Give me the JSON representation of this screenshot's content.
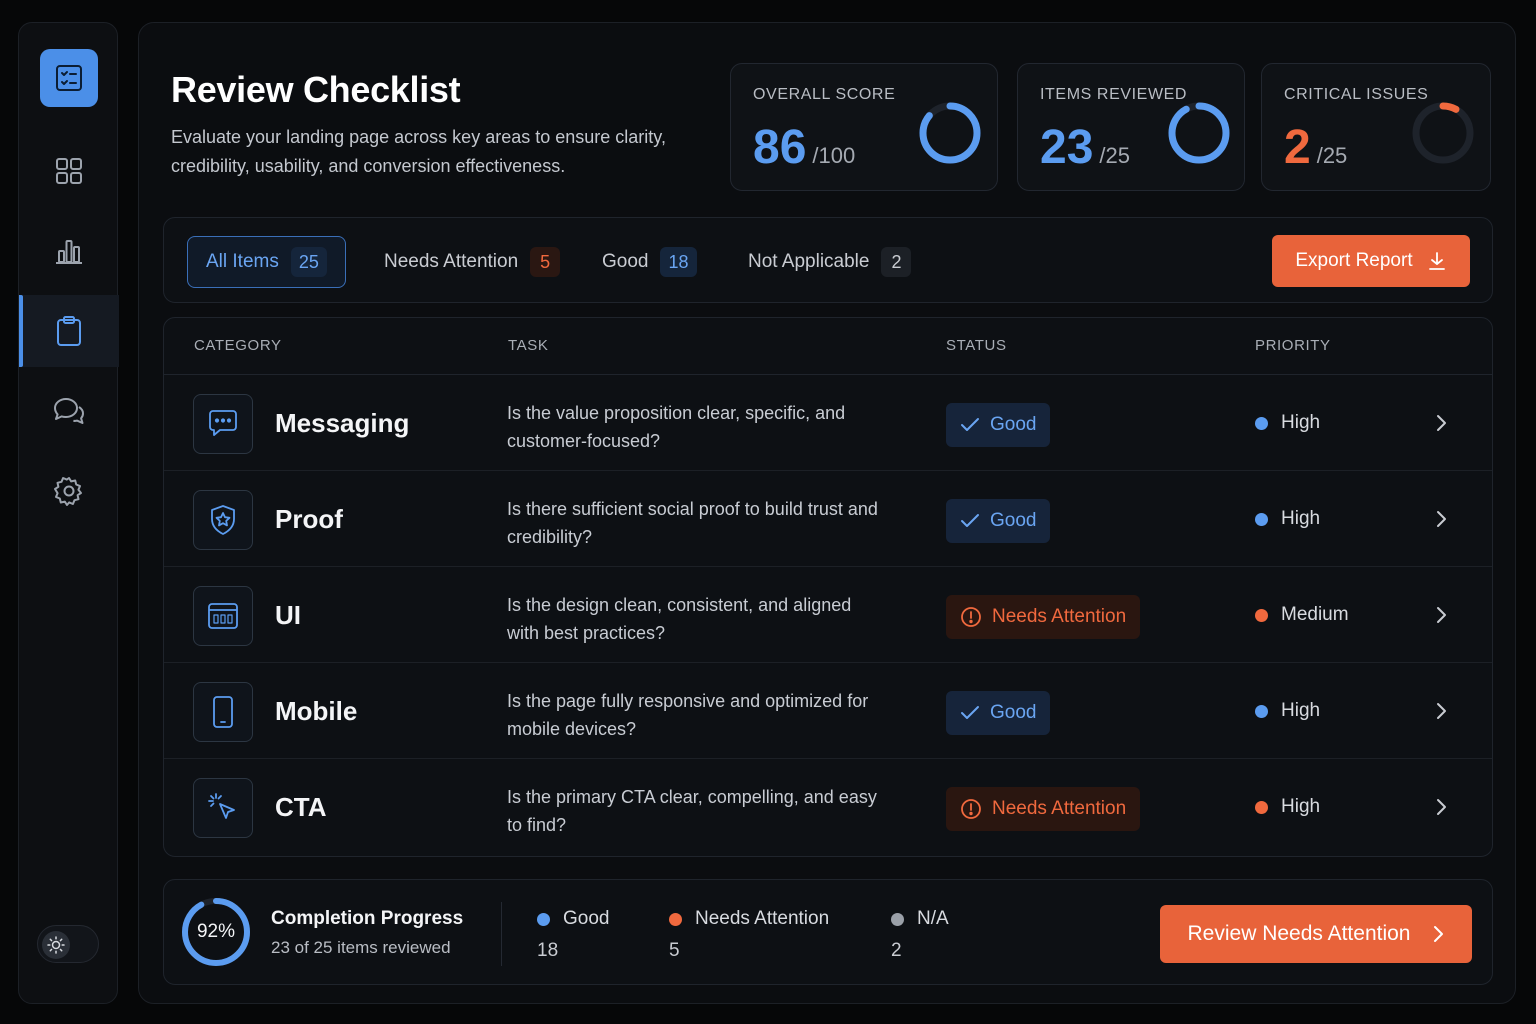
{
  "sidebar": {
    "logo_icon": "checklist-icon",
    "items": [
      {
        "icon": "grid-icon"
      },
      {
        "icon": "bar-chart-icon"
      },
      {
        "icon": "clipboard-icon",
        "active": true
      },
      {
        "icon": "chat-icon"
      },
      {
        "icon": "gear-icon"
      }
    ],
    "theme_toggle_icon": "sun-icon"
  },
  "header": {
    "title": "Review Checklist",
    "description": "Evaluate your landing page across key areas to ensure clarity, credibility, usability, and conversion effectiveness."
  },
  "stats": [
    {
      "label": "OVERALL SCORE",
      "value": "86",
      "unit": "/100",
      "fraction": 0.86,
      "color": "#5b9cf0"
    },
    {
      "label": "ITEMS REVIEWED",
      "value": "23",
      "unit": "/25",
      "fraction": 0.92,
      "color": "#5b9cf0"
    },
    {
      "label": "CRITICAL ISSUES",
      "value": "2",
      "unit": "/25",
      "fraction": 0.08,
      "color": "#f0693e"
    }
  ],
  "filters": {
    "tabs": [
      {
        "label": "All Items",
        "count": "25"
      },
      {
        "label": "Needs Attention",
        "count": "5"
      },
      {
        "label": "Good",
        "count": "18"
      },
      {
        "label": "Not Applicable",
        "count": "2"
      }
    ],
    "export_label": "Export Report"
  },
  "table": {
    "headers": {
      "category": "CATEGORY",
      "task": "TASK",
      "status": "STATUS",
      "priority": "PRIORITY"
    },
    "rows": [
      {
        "category": "Messaging",
        "icon": "message-icon",
        "task": "Is the value proposition clear, specific, and customer-focused?",
        "status": "Good",
        "priority": "High"
      },
      {
        "category": "Proof",
        "icon": "shield-star-icon",
        "task": "Is there sufficient social proof to build trust and credibility?",
        "status": "Good",
        "priority": "High"
      },
      {
        "category": "UI",
        "icon": "browser-window-icon",
        "task": "Is the design clean, consistent, and aligned with best practices?",
        "status": "Needs Attention",
        "priority": "Medium"
      },
      {
        "category": "Mobile",
        "icon": "mobile-phone-icon",
        "task": "Is the page fully responsive and optimized for mobile devices?",
        "status": "Good",
        "priority": "High"
      },
      {
        "category": "CTA",
        "icon": "cursor-click-icon",
        "task": "Is the primary CTA clear, compelling, and easy to find?",
        "status": "Needs Attention",
        "priority": "High"
      }
    ]
  },
  "footer": {
    "progress_pct": "92%",
    "progress_fraction": 0.92,
    "title": "Completion Progress",
    "subtitle": "23 of 25 items reviewed",
    "legend": [
      {
        "label": "Good",
        "count": "18",
        "color": "blue"
      },
      {
        "label": "Needs Attention",
        "count": "5",
        "color": "orange"
      },
      {
        "label": "N/A",
        "count": "2",
        "color": "gray"
      }
    ],
    "review_label": "Review Needs Attention"
  }
}
